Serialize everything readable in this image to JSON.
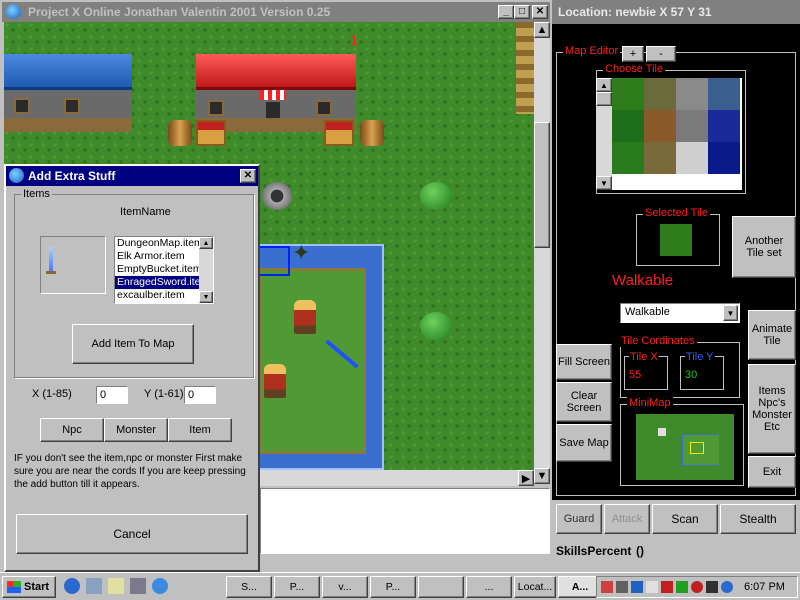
{
  "game_window": {
    "title": "Project X  Online Jonathan Valentin 2001 Version 0.25",
    "map_marker": "1"
  },
  "side_panel": {
    "location_label": "Location: newbie X 57 Y 31",
    "map_editor": {
      "label": "Map Editor",
      "plus": "+",
      "minus": "-",
      "choose_tile_label": "Choose Tile",
      "tile_colors": [
        "#2e7d1a",
        "#6b6a3a",
        "#8a8a8a",
        "#3a5f8f",
        "#1f6e1a",
        "#8a5a2a",
        "#7a7a7a",
        "#1a2a9a",
        "#2a7a1e",
        "#7a6a3a",
        "#cfcfcf",
        "#0a1a8a"
      ],
      "selected_tile_label": "Selected Tile",
      "selected_tile_color": "#2e7d1a",
      "another_tile_set": "Another Tile set",
      "walkable_text": "Walkable",
      "walkable_select": "Walkable",
      "tile_cords_label": "Tile Cordinates",
      "tile_x_label": "Tile X",
      "tile_x_value": "55",
      "tile_y_label": "Tile Y",
      "tile_y_value": "30",
      "animate_tile": "Animate Tile",
      "fill_screen": "Fill Screen",
      "clear_screen": "Clear Screen",
      "save_map": "Save Map",
      "minimap_label": "MiniMap",
      "items_btn": "Items Npc's Monster Etc",
      "exit_btn": "Exit"
    },
    "actions": {
      "guard": "Guard",
      "attack": "Attack",
      "scan": "Scan",
      "stealth": "Stealth"
    },
    "skills_label": "SkillsPercent",
    "skills_value": "()"
  },
  "dialog": {
    "title": "Add Extra Stuff",
    "items_group": "Items",
    "item_name_header": "ItemName",
    "items": [
      "DungeonMap.item",
      "Elk Armor.item",
      "EmptyBucket.item",
      "EnragedSword.item",
      "excaulber.item"
    ],
    "selected_index": 3,
    "add_item_button": "Add Item To Map",
    "x_label": "X (1-85)",
    "x_value": "0",
    "y_label": "Y (1-61)",
    "y_value": "0",
    "tabs": [
      "Npc",
      "Monster",
      "Item"
    ],
    "hint": "IF you don't see the item,npc or monster First make sure you are near the cords If you are keep pressing the add button till it appears.",
    "cancel_button": "Cancel"
  },
  "taskbar": {
    "start": "Start",
    "tasks": [
      "S...",
      "P...",
      "v...",
      "P...",
      "",
      "...",
      "Locat...",
      "A..."
    ],
    "clock": "6:07 PM"
  }
}
